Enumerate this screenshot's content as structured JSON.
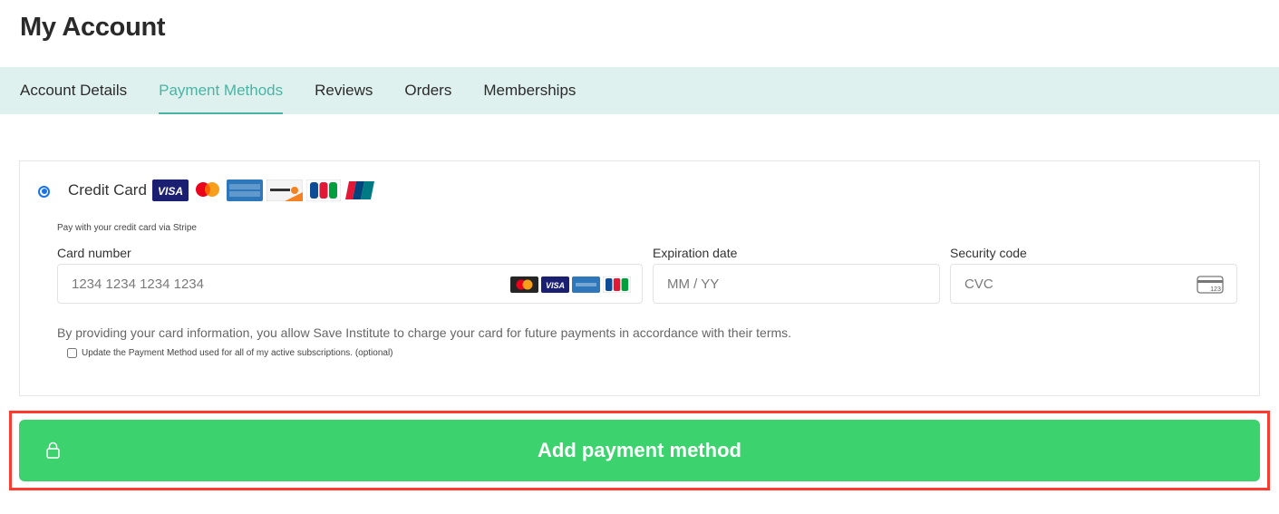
{
  "page": {
    "title": "My Account"
  },
  "tabs": [
    {
      "label": "Account Details",
      "active": false
    },
    {
      "label": "Payment Methods",
      "active": true
    },
    {
      "label": "Reviews",
      "active": false
    },
    {
      "label": "Orders",
      "active": false
    },
    {
      "label": "Memberships",
      "active": false
    }
  ],
  "payment": {
    "method_label": "Credit Card",
    "method_selected": true,
    "accepted_logos": [
      "visa-logo",
      "mastercard-logo",
      "amex-logo",
      "discover-logo",
      "jcb-logo",
      "unionpay-logo"
    ],
    "stripe_note": "Pay with your credit card via Stripe",
    "card_number": {
      "label": "Card number",
      "placeholder": "1234 1234 1234 1234",
      "value": ""
    },
    "expiry": {
      "label": "Expiration date",
      "placeholder": "MM / YY",
      "value": ""
    },
    "cvc": {
      "label": "Security code",
      "placeholder": "CVC",
      "value": ""
    },
    "consent_text": "By providing your card information, you allow Save Institute to charge your card for future payments in accordance with their terms.",
    "update_subscriptions": {
      "label": "Update the Payment Method used for all of my active subscriptions. (optional)",
      "checked": false
    }
  },
  "submit": {
    "label": "Add payment method"
  },
  "colors": {
    "accent": "#4bb3a4",
    "tab_bar": "#dff1ee",
    "button": "#3cd26e",
    "highlight": "#ff3b30"
  }
}
